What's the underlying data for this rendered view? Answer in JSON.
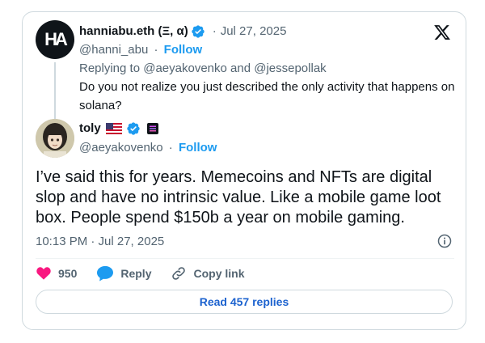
{
  "parent": {
    "avatar_text": "HA",
    "name": "hanniabu.eth (Ξ, α)",
    "date": "Jul 27, 2025",
    "handle": "@hanni_abu",
    "follow": "Follow",
    "replying_prefix": "Replying to",
    "reply_to_1": "@aeyakovenko",
    "reply_and": "and",
    "reply_to_2": "@jessepollak",
    "text": "Do you not realize you just described the only activity that happens on solana?"
  },
  "tweet": {
    "name": "toly",
    "handle": "@aeyakovenko",
    "follow": "Follow",
    "text": "I’ve said this for years.  Memecoins and NFTs are digital slop and have no intrinsic value.  Like a mobile game loot box.  People spend $150b a year on mobile gaming.",
    "timestamp": "10:13 PM · Jul 27, 2025"
  },
  "actions": {
    "likes": "950",
    "reply": "Reply",
    "copy_link": "Copy link"
  },
  "read_replies": "Read 457 replies",
  "colors": {
    "accent": "#1d9bf0",
    "like": "#f91880",
    "text": "#0f1419",
    "muted": "#536471"
  },
  "icons": [
    "x-logo-icon",
    "verified-icon",
    "us-flag-icon",
    "badge-icon",
    "info-icon",
    "heart-icon",
    "reply-icon",
    "link-icon"
  ]
}
